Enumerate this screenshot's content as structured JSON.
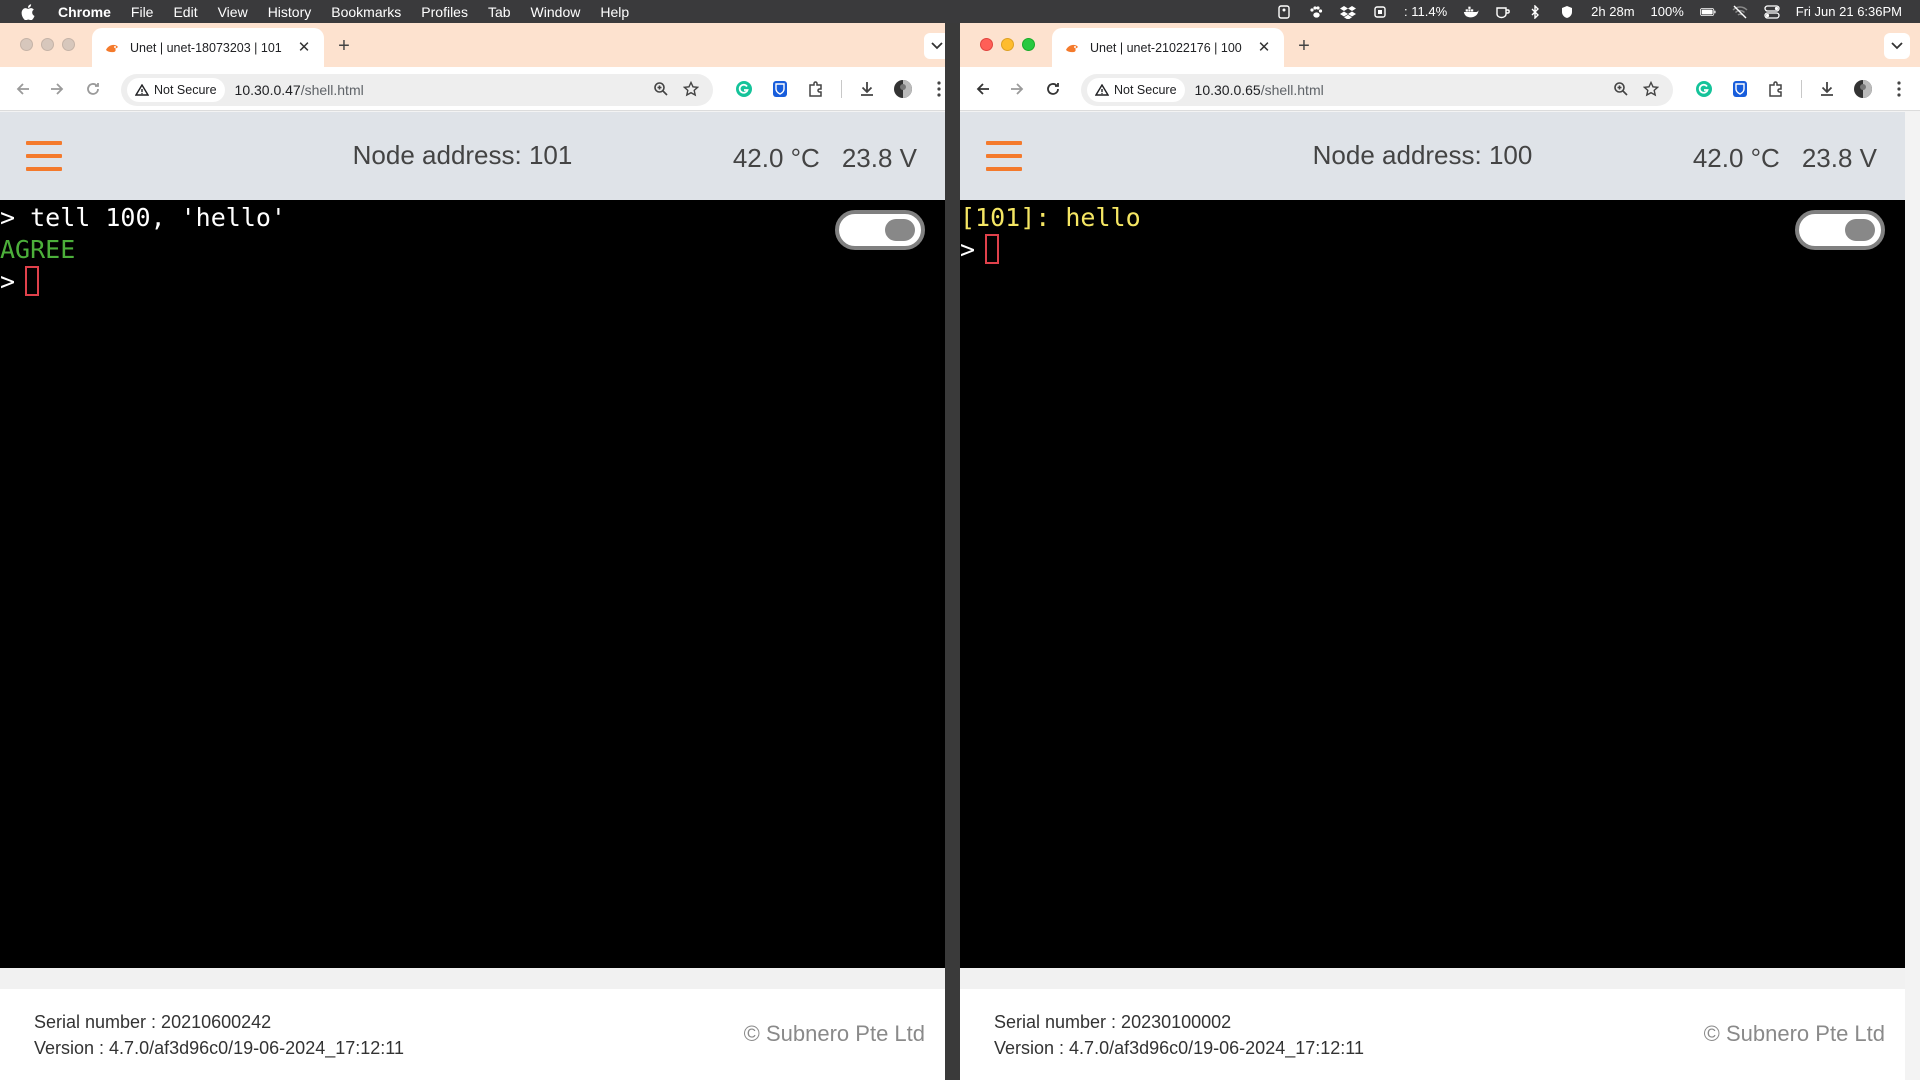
{
  "menubar": {
    "app": "Chrome",
    "items": [
      "File",
      "Edit",
      "View",
      "History",
      "Bookmarks",
      "Profiles",
      "Tab",
      "Window",
      "Help"
    ],
    "status": {
      "cpu": ": 11.4%",
      "battery_time": "2h 28m",
      "battery_pct": "100%",
      "datetime": "Fri Jun 21  6:36PM"
    }
  },
  "left": {
    "tab_title": "Unet | unet-18073203 | 101",
    "security_chip": "Not Secure",
    "url_host": "10.30.0.47",
    "url_path": "/shell.html",
    "node_address": "Node address: 101",
    "temperature": "42.0 °C",
    "voltage": "23.8 V",
    "terminal": {
      "line1": "> tell 100, 'hello'",
      "line2": "AGREE",
      "prompt": ">"
    },
    "serial": "Serial number : 20210600242",
    "version": "Version : 4.7.0/af3d96c0/19-06-2024_17:12:11",
    "copyright": "© Subnero Pte Ltd"
  },
  "right": {
    "tab_title": "Unet | unet-21022176 | 100",
    "security_chip": "Not Secure",
    "url_host": "10.30.0.65",
    "url_path": "/shell.html",
    "node_address": "Node address: 100",
    "temperature": "42.0 °C",
    "voltage": "23.8 V",
    "terminal": {
      "line1": "[101]: hello",
      "prompt": ">"
    },
    "serial": "Serial number : 20230100002",
    "version": "Version : 4.7.0/af3d96c0/19-06-2024_17:12:11",
    "copyright": "© Subnero Pte Ltd"
  },
  "colors": {
    "accent": "#f47a2c",
    "tabstrip": "#fde2cf",
    "terminal_bg": "#000000",
    "agree_green": "#4caf3a",
    "message_yellow": "#f5e663",
    "cursor_red": "#e0414b"
  }
}
